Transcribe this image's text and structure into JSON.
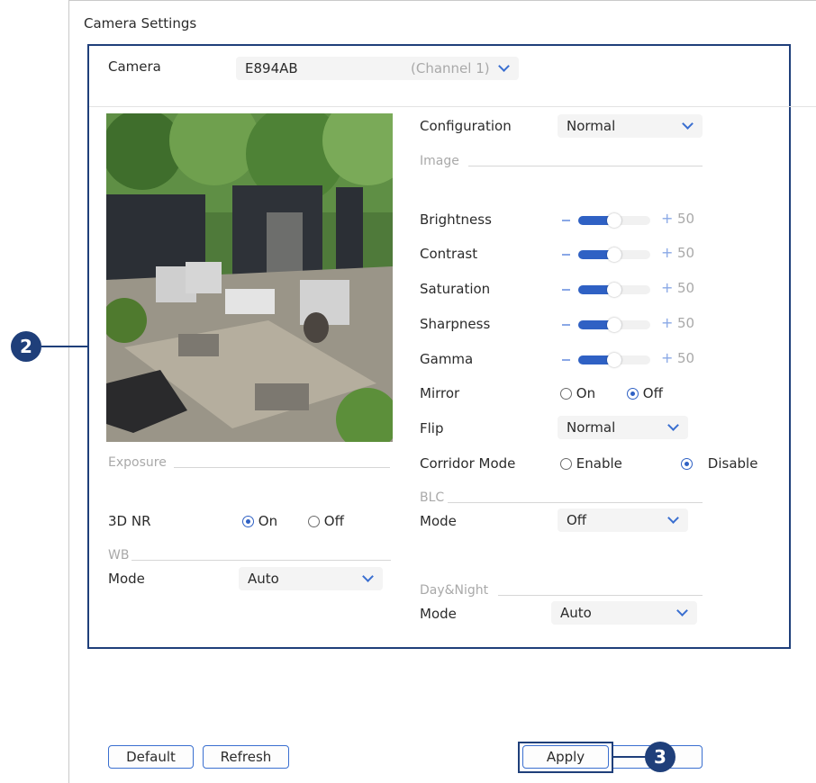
{
  "page": {
    "title": "Camera Settings"
  },
  "camera": {
    "label": "Camera",
    "value": "E894AB",
    "channel": "(Channel 1)"
  },
  "configuration": {
    "label": "Configuration",
    "value": "Normal"
  },
  "image_section": {
    "title": "Image",
    "sliders": [
      {
        "label": "Brightness",
        "value": 50
      },
      {
        "label": "Contrast",
        "value": 50
      },
      {
        "label": "Saturation",
        "value": 50
      },
      {
        "label": "Sharpness",
        "value": 50
      },
      {
        "label": "Gamma",
        "value": 50
      }
    ],
    "minus": "–",
    "plus": "+"
  },
  "mirror": {
    "label": "Mirror",
    "options": [
      "On",
      "Off"
    ],
    "selected": "Off"
  },
  "flip": {
    "label": "Flip",
    "value": "Normal"
  },
  "corridor": {
    "label": "Corridor Mode",
    "options": [
      "Enable",
      "Disable"
    ],
    "selected": "Disable"
  },
  "exposure": {
    "title": "Exposure"
  },
  "nr3d": {
    "label": "3D NR",
    "options": [
      "On",
      "Off"
    ],
    "selected": "On"
  },
  "wb": {
    "title": "WB",
    "mode_label": "Mode",
    "value": "Auto"
  },
  "blc": {
    "title": "BLC",
    "mode_label": "Mode",
    "value": "Off"
  },
  "daynight": {
    "title": "Day&Night",
    "mode_label": "Mode",
    "value": "Auto"
  },
  "buttons": {
    "default": "Default",
    "refresh": "Refresh",
    "apply": "Apply"
  },
  "callouts": {
    "two": "2",
    "three": "3"
  },
  "colors": {
    "accent": "#2f61c4",
    "highlight": "#1f3f7a"
  }
}
